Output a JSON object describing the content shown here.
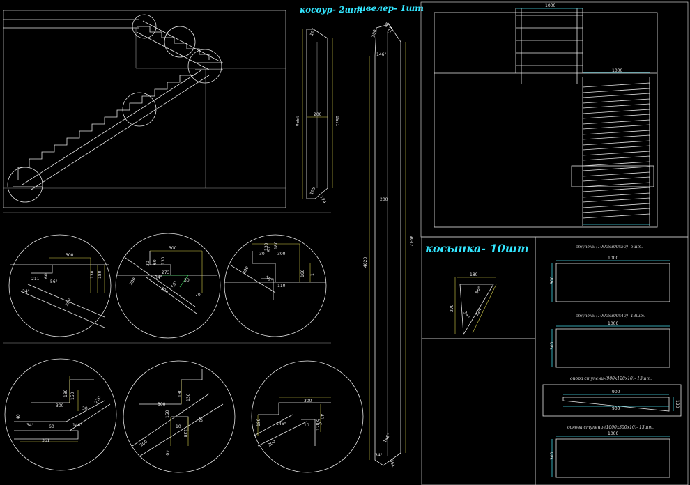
{
  "titles": {
    "kosour": "косоур- 2шт",
    "shveler": "швелер- 1шт",
    "kosynka": "косынка- 10шт"
  },
  "kosour_dims": {
    "d1": "167",
    "d2": "1550",
    "d3": "200",
    "d4": "1571",
    "d5": "165",
    "d6": "174"
  },
  "shveler_dims": {
    "d1": "300",
    "d2": "45",
    "d3": "124",
    "d4": "146°",
    "d5": "200",
    "d6": "4020",
    "d7": "3947",
    "d8": "146°",
    "d9": "34°",
    "d10": "361"
  },
  "kosynka_dims": {
    "d1": "180",
    "d2": "270",
    "d3": "324",
    "d4": "56°",
    "d5": "34°"
  },
  "parts": [
    {
      "label": "ступень-(1000x300x50)- 5шт.",
      "w": "1000",
      "h": "300"
    },
    {
      "label": "ступень-(1000x300x40)- 13шт.",
      "w": "1000",
      "h": "300"
    },
    {
      "label": "опора ступени-(900x120x10)- 13шт.",
      "w": "900",
      "w2": "900",
      "h": "120"
    },
    {
      "label": "основа ступени-(1000x300x10)- 13шт.",
      "w": "1000",
      "h": "300"
    }
  ],
  "plan_dims": {
    "top": "1000",
    "mid": "1000"
  },
  "details_row1": [
    {
      "d1": "300",
      "d2": "211",
      "d3": "60",
      "d4": "130",
      "d5": "180",
      "d6": "56°",
      "d7": "34°",
      "d8": "200"
    },
    {
      "d1": "300",
      "d2": "30",
      "d3": "60",
      "d4": "130",
      "d5": "273",
      "d6": "324",
      "d7": "56°",
      "d8": "200",
      "d9": "34°",
      "d10": "30",
      "d11": "70"
    },
    {
      "d1": "300",
      "d2": "180",
      "d3": "130",
      "d4": "30",
      "d5": "60",
      "d6": "200",
      "d7": "110",
      "d8": "56°",
      "d9": "160",
      "d10": "1"
    }
  ],
  "details_row2": [
    {
      "d1": "180",
      "d2": "150",
      "d3": "300",
      "d4": "30",
      "d5": "220",
      "d6": "40",
      "d7": "34°",
      "d8": "60",
      "d9": "146°",
      "d10": "361"
    },
    {
      "d1": "180",
      "d2": "130",
      "d3": "300",
      "d4": "150",
      "d5": "10",
      "d6": "10",
      "d7": "120",
      "d8": "200",
      "d9": "40"
    },
    {
      "d1": "300",
      "d2": "180",
      "d3": "146°",
      "d4": "10",
      "d5": "120",
      "d6": "200",
      "d7": "34°",
      "d8": "40"
    }
  ]
}
